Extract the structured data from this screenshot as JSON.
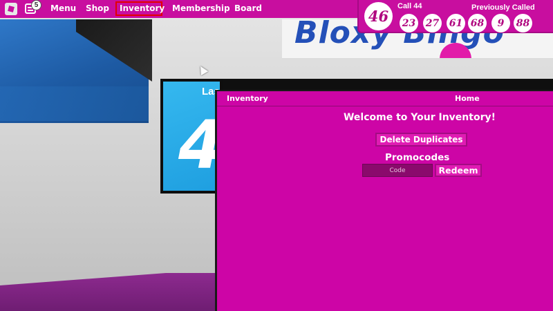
{
  "topbar": {
    "chat_badge": "5",
    "menu": {
      "menu_label": "Menu",
      "shop_label": "Shop",
      "inventory_label": "Inventory",
      "membership_label": "Membership",
      "board_label": "Board"
    },
    "active_item": "Inventory",
    "colors": {
      "bar": "#c80e9f",
      "highlight_border": "#e30000"
    }
  },
  "bingo": {
    "current_ball": "46",
    "call_label": "Call 44",
    "previous_label": "Previously Called",
    "previous_balls": [
      "23",
      "27",
      "61",
      "68",
      "9",
      "88"
    ]
  },
  "inventory": {
    "title": "Inventory",
    "home_label": "Home",
    "welcome": "Welcome to Your Inventory!",
    "delete_duplicates_label": "Delete Duplicates",
    "promocodes_label": "Promocodes",
    "code_placeholder": "Code",
    "code_value": "",
    "redeem_label": "Redeem",
    "colors": {
      "panel": "#cd05a6",
      "button": "#e01cb3",
      "input": "#8a0a6c"
    }
  },
  "scene": {
    "screen_label": "Last Called",
    "screen_number": "4",
    "billboard_text": "Bloxy Bingo"
  },
  "icons": {
    "roblox": "roblox-logo-icon",
    "chat": "chat-icon",
    "cursor": "cursor-icon"
  }
}
